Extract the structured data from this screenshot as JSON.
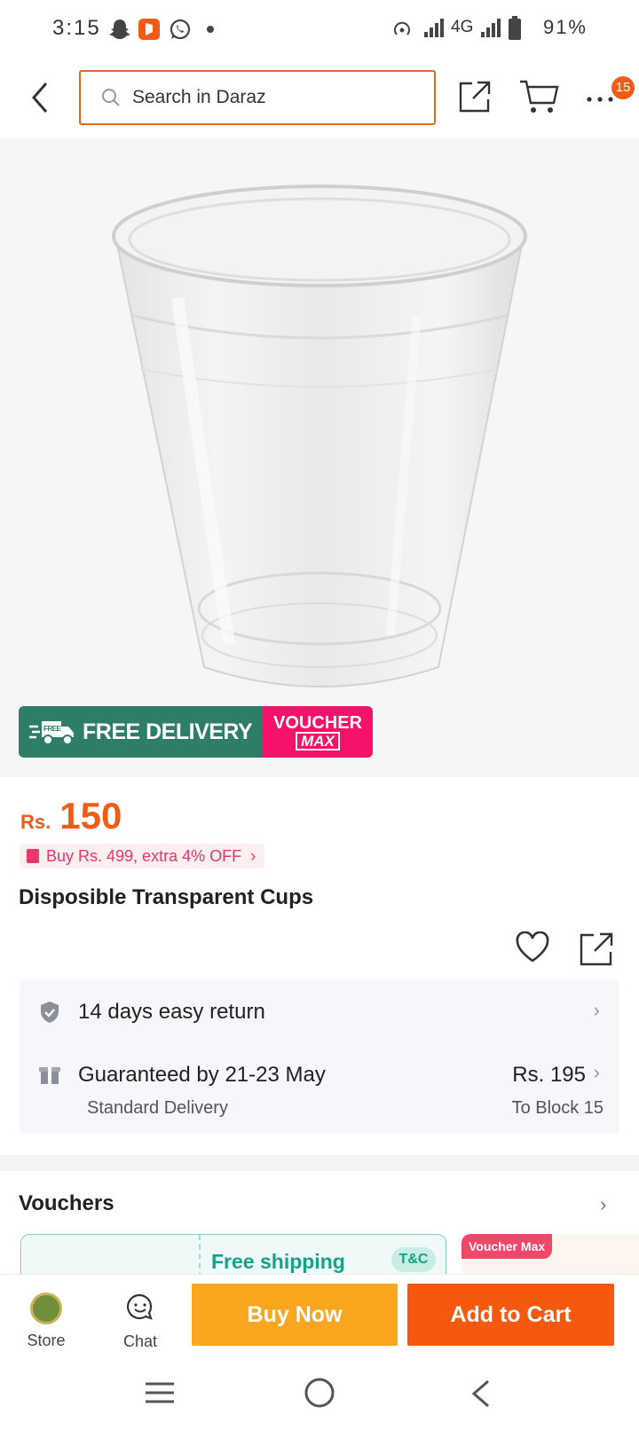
{
  "status": {
    "time": "3:15",
    "network": "4G",
    "battery": "91%"
  },
  "header": {
    "search_placeholder": "Search in Daraz",
    "cart_badge": "15"
  },
  "product": {
    "banner_free_delivery": "FREE DELIVERY",
    "banner_free_tag": "FREE",
    "banner_voucher": "VOUCHER",
    "banner_max": "MAX",
    "price_currency": "Rs.",
    "price_value": "150",
    "promo_text": "Buy Rs. 499, extra 4% OFF",
    "title": "Disposible Transparent Cups"
  },
  "info": {
    "return_text": "14 days easy return",
    "delivery_text": "Guaranteed by 21-23 May",
    "delivery_type": "Standard Delivery",
    "delivery_fee": "Rs. 195",
    "delivery_dest": "To Block 15"
  },
  "vouchers": {
    "title": "Vouchers",
    "card1_label": "Free shipping",
    "card1_tc": "T&C",
    "card2_label": "Voucher Max"
  },
  "actions": {
    "store_label": "Store",
    "chat_label": "Chat",
    "buy_now": "Buy Now",
    "add_to_cart": "Add to Cart"
  },
  "colors": {
    "brand_orange": "#f5580f",
    "buy_yellow": "#fca620",
    "free_delivery_green": "#2e7d67",
    "voucher_pink": "#f6116b"
  }
}
